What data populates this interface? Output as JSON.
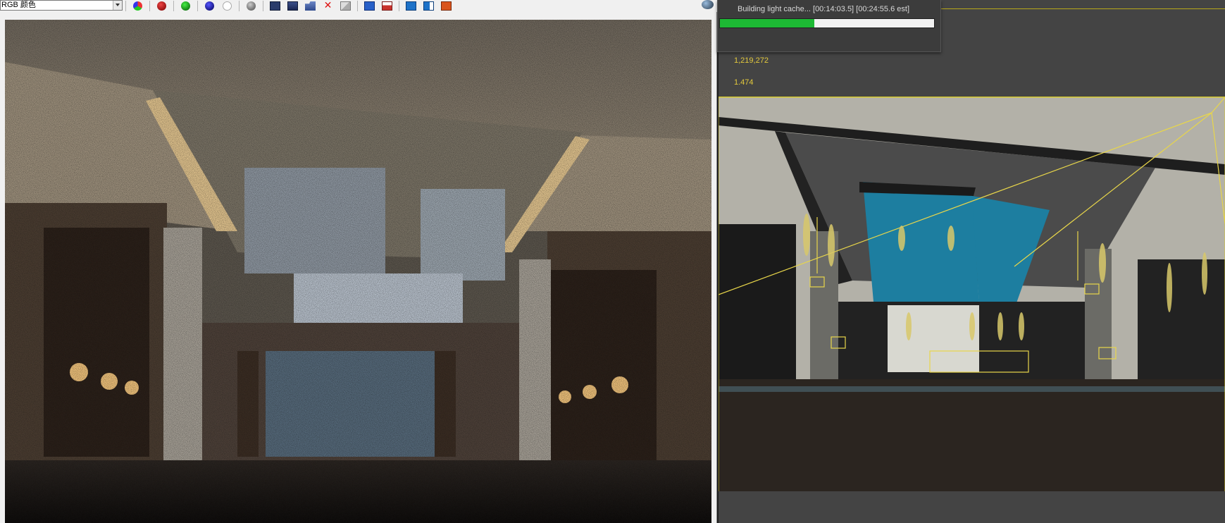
{
  "framebuffer": {
    "channel_select": {
      "value": "RGB 颜色"
    },
    "toolbar": [
      {
        "icon": "rgb-channel-icon"
      },
      {
        "icon": "red-channel-icon"
      },
      {
        "icon": "green-channel-icon"
      },
      {
        "icon": "blue-channel-icon"
      },
      {
        "icon": "alpha-channel-icon"
      },
      {
        "icon": "mono-channel-icon"
      },
      {
        "icon": "save-image-icon"
      },
      {
        "icon": "save-all-icon"
      },
      {
        "icon": "open-image-icon"
      },
      {
        "icon": "clear-icon"
      },
      {
        "icon": "erase-icon"
      },
      {
        "icon": "track-mouse-icon"
      },
      {
        "icon": "render-region-icon"
      },
      {
        "icon": "history-icon"
      },
      {
        "icon": "lens-effects-icon"
      },
      {
        "icon": "color-corrections-icon"
      }
    ]
  },
  "progress": {
    "text": "Building light cache... [00:14:03.5] [00:24:55.6 est]",
    "fraction": 0.44,
    "fill_color": "#1db934"
  },
  "viewport_stats": {
    "row1": {
      "label": "",
      "value": "1,219,272"
    },
    "row2": {
      "label": "",
      "value": "1.474"
    }
  },
  "colors": {
    "stats_text": "#e3c93c",
    "viewport_bg": "#444444",
    "wireframe": "#e8d64a",
    "ceiling_blue": "#1d7ea0"
  }
}
